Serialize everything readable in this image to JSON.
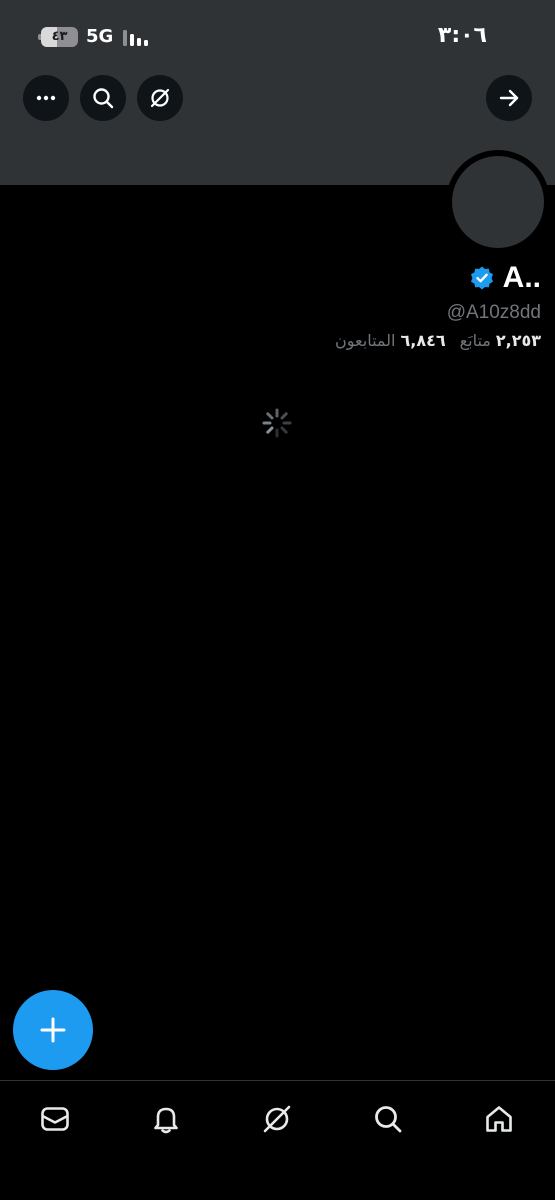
{
  "status_bar": {
    "battery": "٤٣",
    "battery_level": 0.43,
    "network": "5G",
    "time": "٣:٠٦"
  },
  "header": {
    "buttons": [
      {
        "icon": "more-icon"
      },
      {
        "icon": "search-icon"
      },
      {
        "icon": "grok-icon"
      },
      {
        "icon": "arrow-forward-icon"
      }
    ]
  },
  "profile": {
    "name": "A..",
    "verified": true,
    "handle": "@A10z8dd",
    "following_count": "٢,٢٥٣",
    "following_label": "متابَع",
    "followers_count": "٦,٨٤٦",
    "followers_label": "المتابعون"
  },
  "fab": {
    "icon": "plus-icon"
  },
  "bottom_nav": [
    {
      "icon": "mail-icon"
    },
    {
      "icon": "bell-icon"
    },
    {
      "icon": "grok-icon"
    },
    {
      "icon": "search-icon"
    },
    {
      "icon": "home-icon"
    }
  ],
  "colors": {
    "accent": "#1d9bf0",
    "banner": "#2f3336",
    "background": "#000000",
    "secondary_text": "#71767b"
  }
}
